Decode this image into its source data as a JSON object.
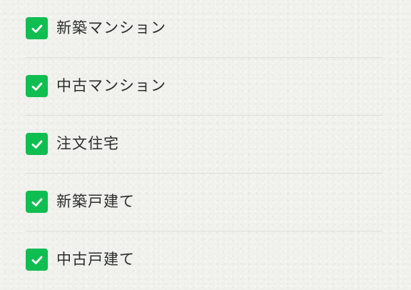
{
  "theme": {
    "checkbox_color": "#0fbe50",
    "check_mark_color": "#ffffff"
  },
  "options": [
    {
      "label": "新築マンション",
      "checked": true
    },
    {
      "label": "中古マンション",
      "checked": true
    },
    {
      "label": "注文住宅",
      "checked": true
    },
    {
      "label": "新築戸建て",
      "checked": true
    },
    {
      "label": "中古戸建て",
      "checked": true
    }
  ]
}
